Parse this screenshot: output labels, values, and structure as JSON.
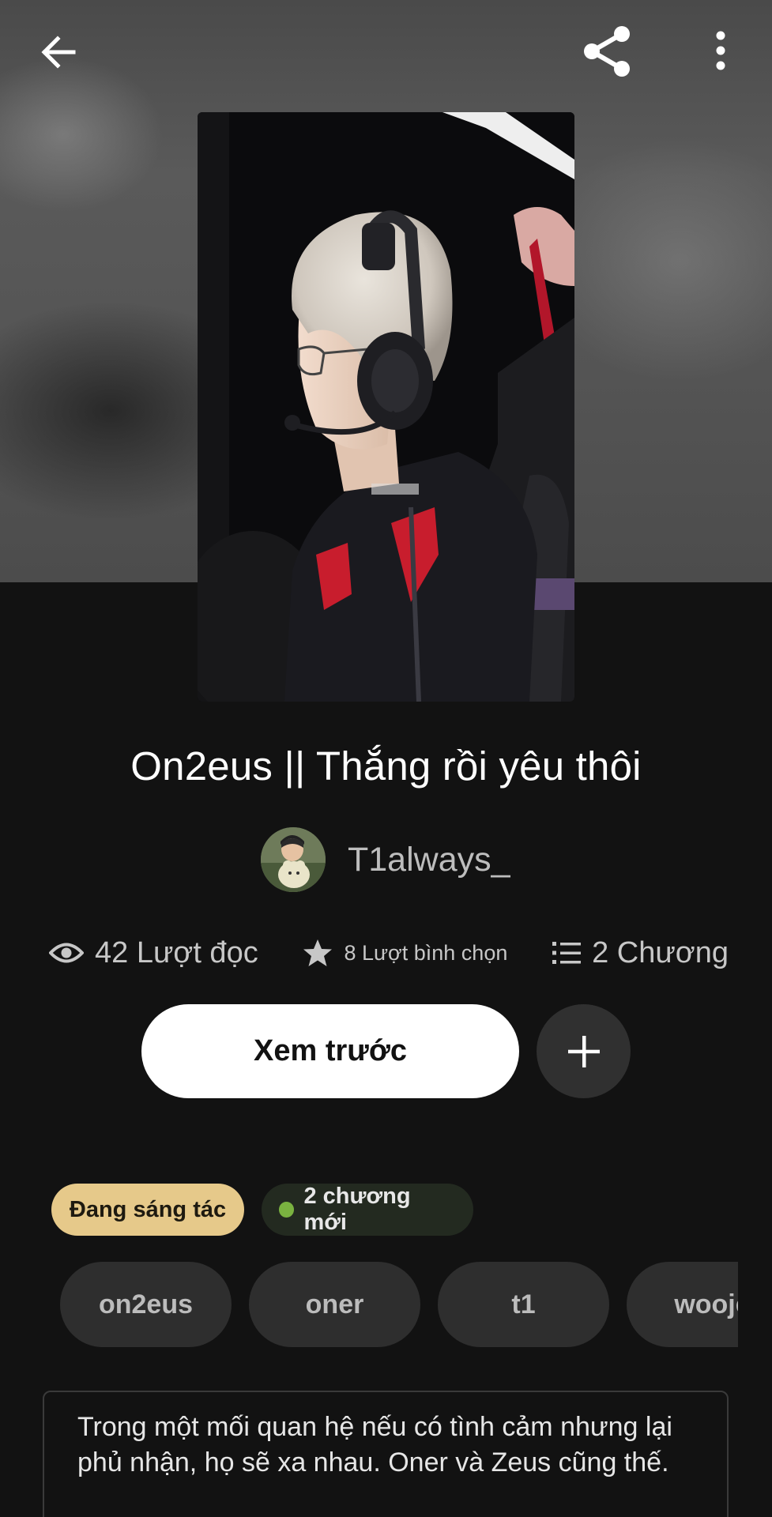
{
  "header": {
    "back_icon": "arrow-left-icon",
    "share_icon": "share-icon",
    "more_icon": "more-vertical-icon"
  },
  "story": {
    "title": "On2eus || Thắng rồi yêu thôi",
    "author": "T1always_",
    "stats": {
      "reads": "42 Lượt đọc",
      "votes": "8 Lượt bình chọn",
      "parts": "2 Chương"
    },
    "preview_label": "Xem trước",
    "add_icon": "plus-icon",
    "status_badge": "Đang sáng tác",
    "new_parts_badge": "2 chương mới",
    "tags": [
      "on2eus",
      "oner",
      "t1",
      "wooje"
    ],
    "description": "Trong một mối quan hệ nếu có tình cảm nhưng lại phủ nhận, họ sẽ xa nhau. Oner và Zeus cũng thế."
  },
  "colors": {
    "background": "#121212",
    "status_badge_bg": "#e6c98a",
    "new_dot": "#7ab240",
    "tag_bg": "#2e2e2e"
  }
}
